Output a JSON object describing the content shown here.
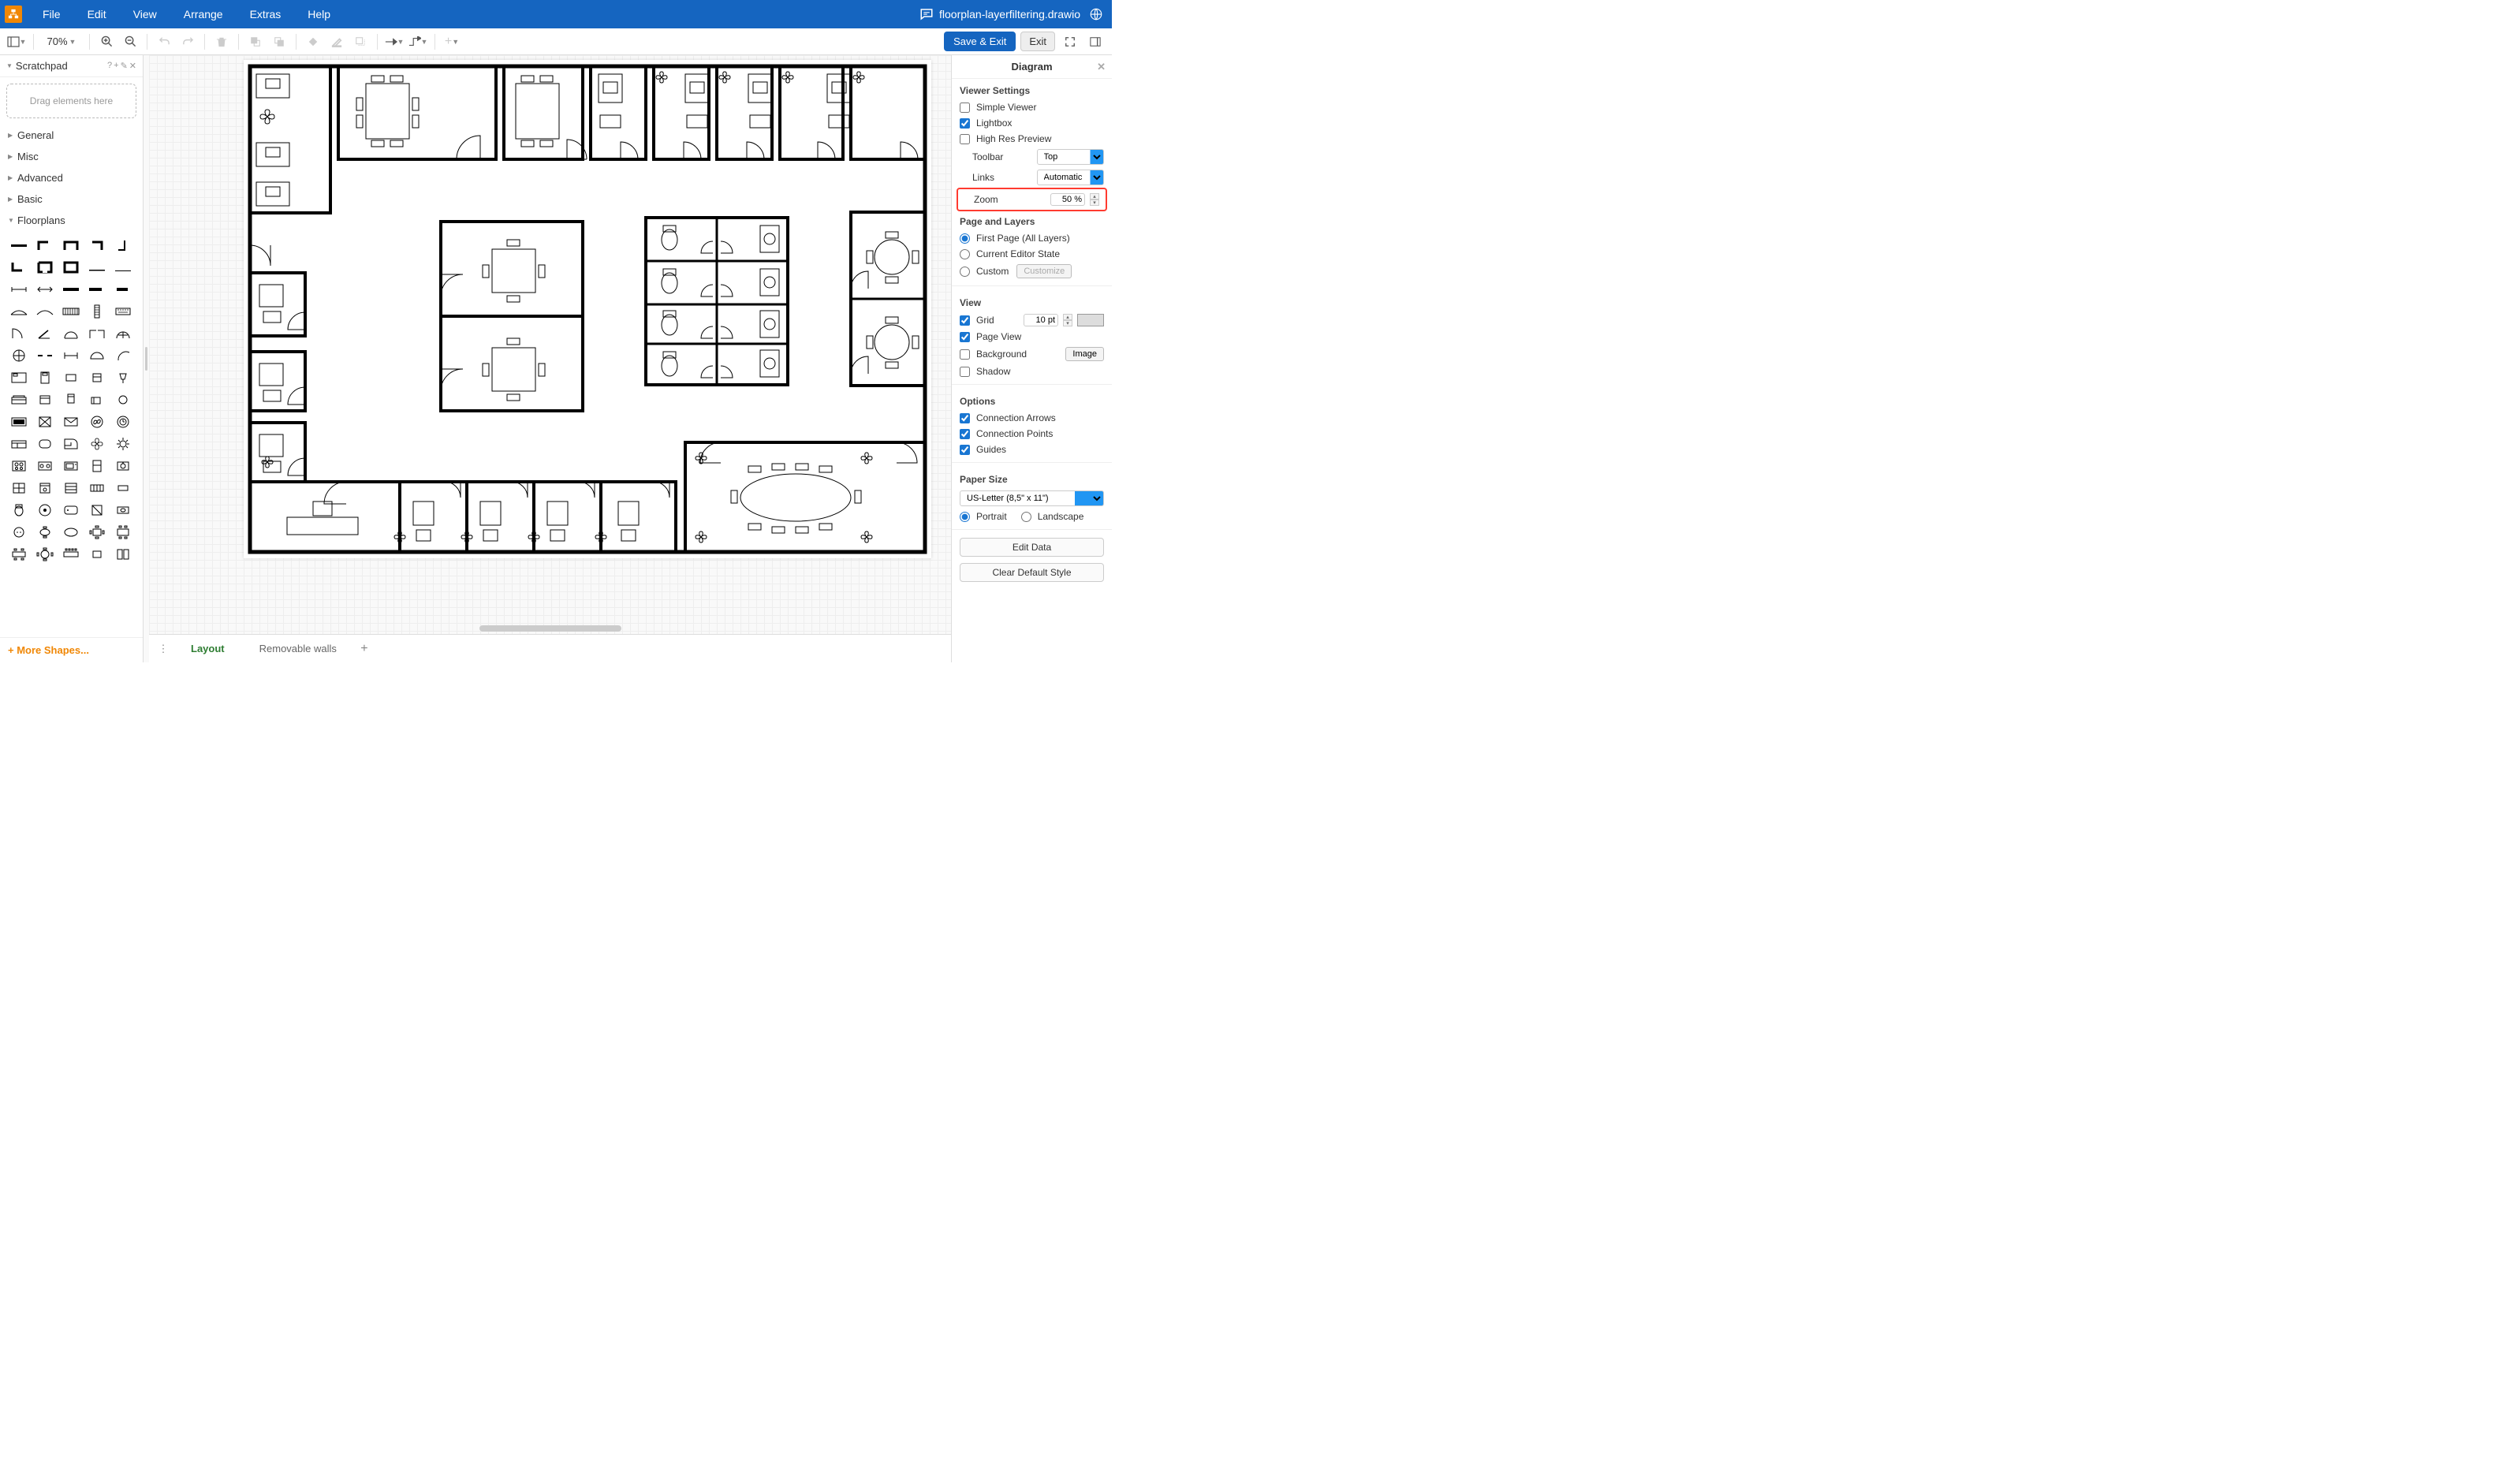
{
  "menubar": {
    "items": [
      "File",
      "Edit",
      "View",
      "Arrange",
      "Extras",
      "Help"
    ],
    "filename": "floorplan-layerfiltering.drawio"
  },
  "toolbar": {
    "zoom_display": "70%",
    "save_exit": "Save & Exit",
    "exit": "Exit"
  },
  "sidebar": {
    "scratchpad": {
      "title": "Scratchpad",
      "drop_hint": "Drag elements here"
    },
    "sections": [
      "General",
      "Misc",
      "Advanced",
      "Basic",
      "Floorplans"
    ],
    "more_shapes": "+ More Shapes..."
  },
  "pagetabs": {
    "tabs": [
      {
        "label": "Layout",
        "active": true
      },
      {
        "label": "Removable walls",
        "active": false
      }
    ]
  },
  "rightpanel": {
    "title": "Diagram",
    "viewer_settings": {
      "heading": "Viewer Settings",
      "simple_viewer": {
        "label": "Simple Viewer",
        "checked": false
      },
      "lightbox": {
        "label": "Lightbox",
        "checked": true
      },
      "high_res": {
        "label": "High Res Preview",
        "checked": false
      },
      "toolbar_label": "Toolbar",
      "toolbar_value": "Top",
      "links_label": "Links",
      "links_value": "Automatic",
      "zoom_label": "Zoom",
      "zoom_value": "50 %"
    },
    "page_layers": {
      "heading": "Page and Layers",
      "first_page": "First Page (All Layers)",
      "current_editor": "Current Editor State",
      "custom": "Custom",
      "customize_btn": "Customize"
    },
    "view": {
      "heading": "View",
      "grid": {
        "label": "Grid",
        "checked": true,
        "value": "10 pt"
      },
      "page_view": {
        "label": "Page View",
        "checked": true
      },
      "background": {
        "label": "Background",
        "checked": false,
        "image_btn": "Image"
      },
      "shadow": {
        "label": "Shadow",
        "checked": false
      }
    },
    "options": {
      "heading": "Options",
      "connection_arrows": {
        "label": "Connection Arrows",
        "checked": true
      },
      "connection_points": {
        "label": "Connection Points",
        "checked": true
      },
      "guides": {
        "label": "Guides",
        "checked": true
      }
    },
    "paper_size": {
      "heading": "Paper Size",
      "value": "US-Letter (8,5\" x 11\")",
      "portrait": "Portrait",
      "landscape": "Landscape"
    },
    "edit_data": "Edit Data",
    "clear_style": "Clear Default Style"
  }
}
